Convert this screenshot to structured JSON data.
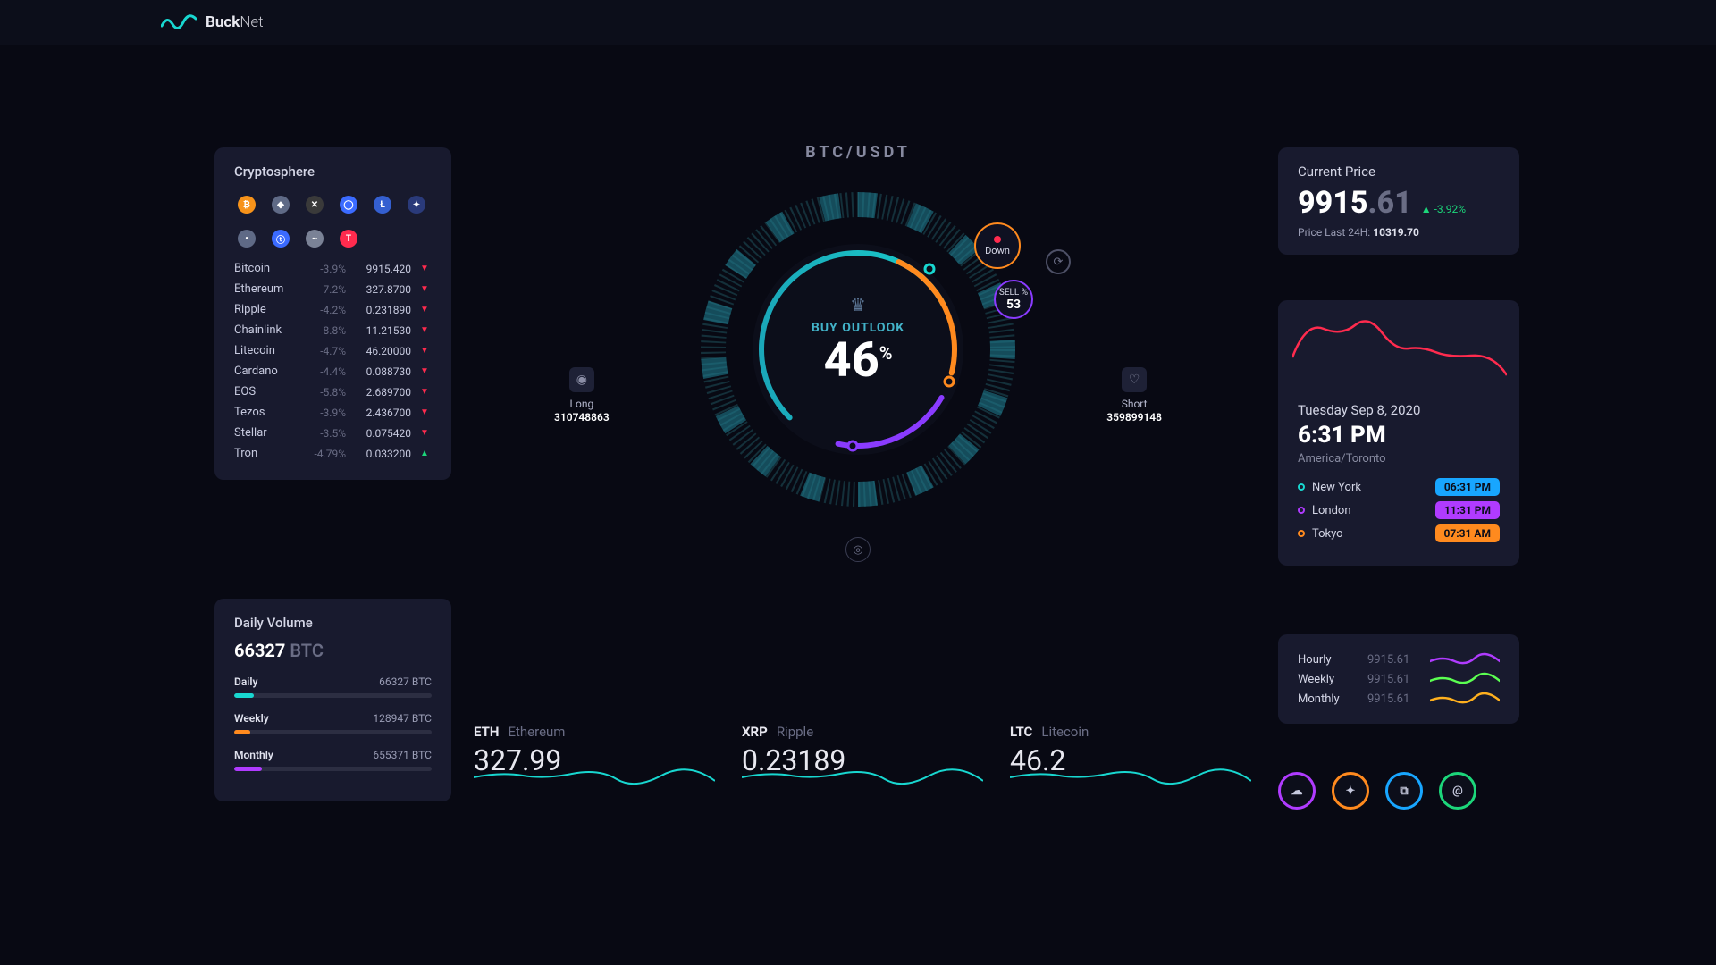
{
  "brand": {
    "bold": "Buck",
    "light": "Net"
  },
  "cryptosphere": {
    "title": "Cryptosphere",
    "icon_colors": [
      "#f7931a",
      "#5f6a86",
      "#3a3a3a",
      "#3b6bff",
      "#345fd0",
      "#2a3a7a",
      "#5f6a86",
      "#3b6bff",
      "#7a8296",
      "#ff2b4e"
    ],
    "rows": [
      {
        "name": "Bitcoin",
        "pct": "-3.9%",
        "price": "9915.420",
        "dir": "down"
      },
      {
        "name": "Ethereum",
        "pct": "-7.2%",
        "price": "327.8700",
        "dir": "down"
      },
      {
        "name": "Ripple",
        "pct": "-4.2%",
        "price": "0.231890",
        "dir": "down"
      },
      {
        "name": "Chainlink",
        "pct": "-8.8%",
        "price": "11.21530",
        "dir": "down"
      },
      {
        "name": "Litecoin",
        "pct": "-4.7%",
        "price": "46.20000",
        "dir": "down"
      },
      {
        "name": "Cardano",
        "pct": "-4.4%",
        "price": "0.088730",
        "dir": "down"
      },
      {
        "name": "EOS",
        "pct": "-5.8%",
        "price": "2.689700",
        "dir": "down"
      },
      {
        "name": "Tezos",
        "pct": "-3.9%",
        "price": "2.436700",
        "dir": "down"
      },
      {
        "name": "Stellar",
        "pct": "-3.5%",
        "price": "0.075420",
        "dir": "down"
      },
      {
        "name": "Tron",
        "pct": "-4.79%",
        "price": "0.033200",
        "dir": "up"
      }
    ]
  },
  "volume": {
    "title": "Daily Volume",
    "main_value": "66327",
    "main_unit": "BTC",
    "rows": [
      {
        "label": "Daily",
        "value": "66327 BTC",
        "pct": 10,
        "color": "#18d7d0"
      },
      {
        "label": "Weekly",
        "value": "128947 BTC",
        "pct": 8,
        "color": "#ff8a1e"
      },
      {
        "label": "Monthly",
        "value": "655371 BTC",
        "pct": 14,
        "color": "#b03bff"
      }
    ]
  },
  "dial": {
    "pair": "BTC/USDT",
    "outlook_label": "BUY OUTLOOK",
    "outlook_value": "46",
    "outlook_suffix": "%",
    "down_label": "Down",
    "sell_label": "SELL %",
    "sell_value": "53",
    "long": {
      "label": "Long",
      "value": "310748863"
    },
    "short": {
      "label": "Short",
      "value": "359899148"
    }
  },
  "sparks": [
    {
      "sym": "ETH",
      "name": "Ethereum",
      "value": "327.99"
    },
    {
      "sym": "XRP",
      "name": "Ripple",
      "value": "0.23189"
    },
    {
      "sym": "LTC",
      "name": "Litecoin",
      "value": "46.2"
    }
  ],
  "price": {
    "label": "Current Price",
    "int": "9915",
    "dec": ".61",
    "change": "-3.92%",
    "sub_label": "Price Last 24H:",
    "sub_value": "10319.70"
  },
  "clock": {
    "date": "Tuesday Sep 8, 2020",
    "time": "6:31 PM",
    "tz": "America/Toronto",
    "cities": [
      {
        "name": "New York",
        "time": "06:31 PM",
        "ring": "#18d7d0",
        "pill": "#18a6ff"
      },
      {
        "name": "London",
        "time": "11:31 PM",
        "ring": "#b03bff",
        "pill": "#b03bff"
      },
      {
        "name": "Tokyo",
        "time": "07:31 AM",
        "ring": "#ff8a1e",
        "pill": "#ff8a1e"
      }
    ]
  },
  "trend": {
    "rows": [
      {
        "label": "Hourly",
        "value": "9915.61",
        "color": "#b03bff"
      },
      {
        "label": "Weekly",
        "value": "9915.61",
        "color": "#5bff51"
      },
      {
        "label": "Monthly",
        "value": "9915.61",
        "color": "#ffb01e"
      }
    ]
  },
  "rings": [
    {
      "color": "#b03bff"
    },
    {
      "color": "#ff8a1e"
    },
    {
      "color": "#18a6ff"
    },
    {
      "color": "#1cd67a"
    }
  ],
  "chart_data": {
    "type": "gauge",
    "title": "BTC/USDT Buy Outlook",
    "value": 46,
    "unit": "%",
    "secondary": {
      "label": "SELL %",
      "value": 53
    },
    "long_volume": 310748863,
    "short_volume": 359899148
  }
}
